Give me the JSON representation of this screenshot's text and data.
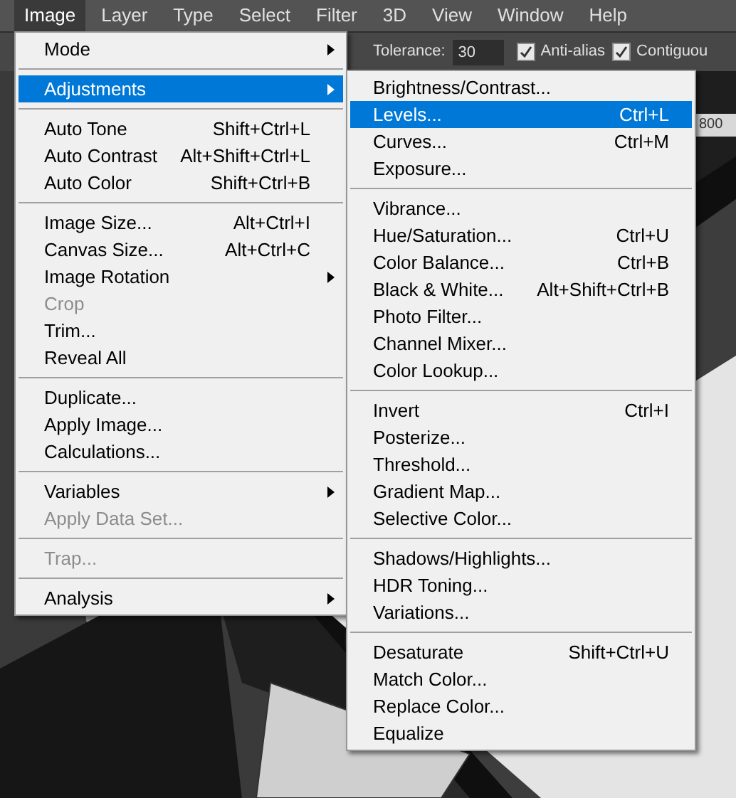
{
  "menu_bar": [
    {
      "label": "Image",
      "selected": true
    },
    {
      "label": "Layer",
      "selected": false
    },
    {
      "label": "Type",
      "selected": false
    },
    {
      "label": "Select",
      "selected": false
    },
    {
      "label": "Filter",
      "selected": false
    },
    {
      "label": "3D",
      "selected": false
    },
    {
      "label": "View",
      "selected": false
    },
    {
      "label": "Window",
      "selected": false
    },
    {
      "label": "Help",
      "selected": false
    }
  ],
  "options_bar": {
    "tolerance_label": "Tolerance:",
    "tolerance_value": "30",
    "checkboxes": [
      {
        "label": "Anti-alias",
        "checked": true
      },
      {
        "label": "Contiguou",
        "checked": true
      }
    ]
  },
  "ruler_label": "800",
  "image_menu": [
    [
      {
        "label": "Mode",
        "submenu": true,
        "disabled": false,
        "selected": false
      }
    ],
    [
      {
        "label": "Adjustments",
        "submenu": true,
        "disabled": false,
        "selected": true
      }
    ],
    [
      {
        "label": "Auto Tone",
        "shortcut": "Shift+Ctrl+L",
        "submenu": false,
        "disabled": false,
        "selected": false
      },
      {
        "label": "Auto Contrast",
        "shortcut": "Alt+Shift+Ctrl+L",
        "submenu": false,
        "disabled": false,
        "selected": false
      },
      {
        "label": "Auto Color",
        "shortcut": "Shift+Ctrl+B",
        "submenu": false,
        "disabled": false,
        "selected": false
      }
    ],
    [
      {
        "label": "Image Size...",
        "shortcut": "Alt+Ctrl+I",
        "submenu": false,
        "disabled": false,
        "selected": false
      },
      {
        "label": "Canvas Size...",
        "shortcut": "Alt+Ctrl+C",
        "submenu": false,
        "disabled": false,
        "selected": false
      },
      {
        "label": "Image Rotation",
        "submenu": true,
        "disabled": false,
        "selected": false
      },
      {
        "label": "Crop",
        "submenu": false,
        "disabled": true,
        "selected": false
      },
      {
        "label": "Trim...",
        "submenu": false,
        "disabled": false,
        "selected": false
      },
      {
        "label": "Reveal All",
        "submenu": false,
        "disabled": false,
        "selected": false
      }
    ],
    [
      {
        "label": "Duplicate...",
        "submenu": false,
        "disabled": false,
        "selected": false
      },
      {
        "label": "Apply Image...",
        "submenu": false,
        "disabled": false,
        "selected": false
      },
      {
        "label": "Calculations...",
        "submenu": false,
        "disabled": false,
        "selected": false
      }
    ],
    [
      {
        "label": "Variables",
        "submenu": true,
        "disabled": false,
        "selected": false
      },
      {
        "label": "Apply Data Set...",
        "submenu": false,
        "disabled": true,
        "selected": false
      }
    ],
    [
      {
        "label": "Trap...",
        "submenu": false,
        "disabled": true,
        "selected": false
      }
    ],
    [
      {
        "label": "Analysis",
        "submenu": true,
        "disabled": false,
        "selected": false
      }
    ]
  ],
  "adjustments_submenu": [
    [
      {
        "label": "Brightness/Contrast...",
        "selected": false
      },
      {
        "label": "Levels...",
        "shortcut": "Ctrl+L",
        "selected": true
      },
      {
        "label": "Curves...",
        "shortcut": "Ctrl+M",
        "selected": false
      },
      {
        "label": "Exposure...",
        "selected": false
      }
    ],
    [
      {
        "label": "Vibrance...",
        "selected": false
      },
      {
        "label": "Hue/Saturation...",
        "shortcut": "Ctrl+U",
        "selected": false
      },
      {
        "label": "Color Balance...",
        "shortcut": "Ctrl+B",
        "selected": false
      },
      {
        "label": "Black & White...",
        "shortcut": "Alt+Shift+Ctrl+B",
        "selected": false
      },
      {
        "label": "Photo Filter...",
        "selected": false
      },
      {
        "label": "Channel Mixer...",
        "selected": false
      },
      {
        "label": "Color Lookup...",
        "selected": false
      }
    ],
    [
      {
        "label": "Invert",
        "shortcut": "Ctrl+I",
        "selected": false
      },
      {
        "label": "Posterize...",
        "selected": false
      },
      {
        "label": "Threshold...",
        "selected": false
      },
      {
        "label": "Gradient Map...",
        "selected": false
      },
      {
        "label": "Selective Color...",
        "selected": false
      }
    ],
    [
      {
        "label": "Shadows/Highlights...",
        "selected": false
      },
      {
        "label": "HDR Toning...",
        "selected": false
      },
      {
        "label": "Variations...",
        "selected": false
      }
    ],
    [
      {
        "label": "Desaturate",
        "shortcut": "Shift+Ctrl+U",
        "selected": false
      },
      {
        "label": "Match Color...",
        "selected": false
      },
      {
        "label": "Replace Color...",
        "selected": false
      },
      {
        "label": "Equalize",
        "selected": false
      }
    ]
  ]
}
